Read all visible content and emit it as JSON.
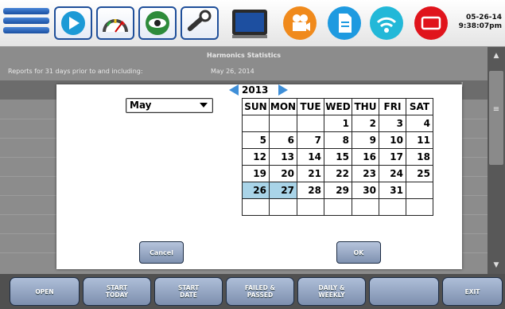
{
  "toolbar": {
    "icons": [
      "menu-icon",
      "play-icon",
      "gauge-icon",
      "eye-icon",
      "wrench-icon",
      "monitor-icon",
      "video-camera-icon",
      "document-icon",
      "wifi-icon",
      "screen-icon"
    ],
    "date": "05-26-14",
    "time": "9:38:07pm"
  },
  "report": {
    "title": "Harmonics Statistics",
    "range_label": "Reports for 31 days prior to and including:",
    "range_date": "May 26, 2014",
    "partial_text": "l"
  },
  "scrollbar": {
    "up_icon": "▲",
    "grip_icon": "≡",
    "down_icon": "▼"
  },
  "dialog": {
    "month": "May",
    "year": "2013",
    "weekdays": [
      "SUN",
      "MON",
      "TUE",
      "WED",
      "THU",
      "FRI",
      "SAT"
    ],
    "weeks": [
      [
        "",
        "",
        "",
        "1",
        "2",
        "3",
        "4"
      ],
      [
        "5",
        "6",
        "7",
        "8",
        "9",
        "10",
        "11"
      ],
      [
        "12",
        "13",
        "14",
        "15",
        "16",
        "17",
        "18"
      ],
      [
        "19",
        "20",
        "21",
        "22",
        "23",
        "24",
        "25"
      ],
      [
        "26",
        "27",
        "28",
        "29",
        "30",
        "31",
        ""
      ],
      [
        "",
        "",
        "",
        "",
        "",
        "",
        ""
      ]
    ],
    "selected_days": [
      "26",
      "27"
    ],
    "cancel_label": "Cancel",
    "ok_label": "OK"
  },
  "bottom_nav": {
    "open": "OPEN",
    "start_today": "START\nTODAY",
    "start_date": "START\nDATE",
    "failed_passed": "FAILED &\nPASSED",
    "daily_weekly": "DAILY &\nWEEKLY",
    "blank": "",
    "exit": "EXIT"
  },
  "colors": {
    "accent": "#1f4f9a",
    "selected_day": "#a9d4e8",
    "year_arrow": "#3f8fd8"
  }
}
